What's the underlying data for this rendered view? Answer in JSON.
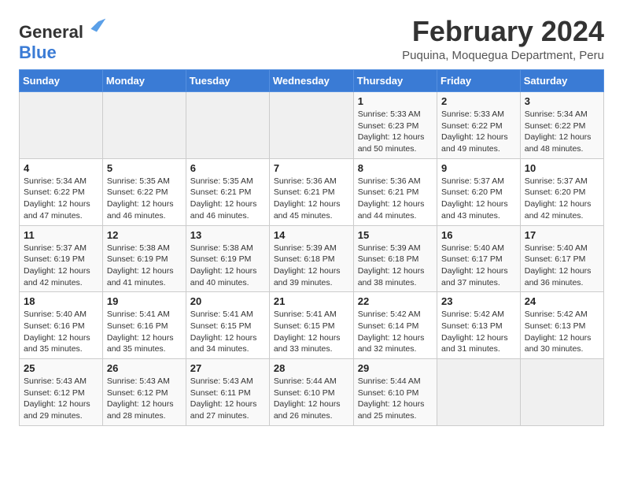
{
  "header": {
    "logo_general": "General",
    "logo_blue": "Blue",
    "month_title": "February 2024",
    "location": "Puquina, Moquegua Department, Peru"
  },
  "weekdays": [
    "Sunday",
    "Monday",
    "Tuesday",
    "Wednesday",
    "Thursday",
    "Friday",
    "Saturday"
  ],
  "weeks": [
    [
      {
        "day": "",
        "info": ""
      },
      {
        "day": "",
        "info": ""
      },
      {
        "day": "",
        "info": ""
      },
      {
        "day": "",
        "info": ""
      },
      {
        "day": "1",
        "info": "Sunrise: 5:33 AM\nSunset: 6:23 PM\nDaylight: 12 hours\nand 50 minutes."
      },
      {
        "day": "2",
        "info": "Sunrise: 5:33 AM\nSunset: 6:22 PM\nDaylight: 12 hours\nand 49 minutes."
      },
      {
        "day": "3",
        "info": "Sunrise: 5:34 AM\nSunset: 6:22 PM\nDaylight: 12 hours\nand 48 minutes."
      }
    ],
    [
      {
        "day": "4",
        "info": "Sunrise: 5:34 AM\nSunset: 6:22 PM\nDaylight: 12 hours\nand 47 minutes."
      },
      {
        "day": "5",
        "info": "Sunrise: 5:35 AM\nSunset: 6:22 PM\nDaylight: 12 hours\nand 46 minutes."
      },
      {
        "day": "6",
        "info": "Sunrise: 5:35 AM\nSunset: 6:21 PM\nDaylight: 12 hours\nand 46 minutes."
      },
      {
        "day": "7",
        "info": "Sunrise: 5:36 AM\nSunset: 6:21 PM\nDaylight: 12 hours\nand 45 minutes."
      },
      {
        "day": "8",
        "info": "Sunrise: 5:36 AM\nSunset: 6:21 PM\nDaylight: 12 hours\nand 44 minutes."
      },
      {
        "day": "9",
        "info": "Sunrise: 5:37 AM\nSunset: 6:20 PM\nDaylight: 12 hours\nand 43 minutes."
      },
      {
        "day": "10",
        "info": "Sunrise: 5:37 AM\nSunset: 6:20 PM\nDaylight: 12 hours\nand 42 minutes."
      }
    ],
    [
      {
        "day": "11",
        "info": "Sunrise: 5:37 AM\nSunset: 6:19 PM\nDaylight: 12 hours\nand 42 minutes."
      },
      {
        "day": "12",
        "info": "Sunrise: 5:38 AM\nSunset: 6:19 PM\nDaylight: 12 hours\nand 41 minutes."
      },
      {
        "day": "13",
        "info": "Sunrise: 5:38 AM\nSunset: 6:19 PM\nDaylight: 12 hours\nand 40 minutes."
      },
      {
        "day": "14",
        "info": "Sunrise: 5:39 AM\nSunset: 6:18 PM\nDaylight: 12 hours\nand 39 minutes."
      },
      {
        "day": "15",
        "info": "Sunrise: 5:39 AM\nSunset: 6:18 PM\nDaylight: 12 hours\nand 38 minutes."
      },
      {
        "day": "16",
        "info": "Sunrise: 5:40 AM\nSunset: 6:17 PM\nDaylight: 12 hours\nand 37 minutes."
      },
      {
        "day": "17",
        "info": "Sunrise: 5:40 AM\nSunset: 6:17 PM\nDaylight: 12 hours\nand 36 minutes."
      }
    ],
    [
      {
        "day": "18",
        "info": "Sunrise: 5:40 AM\nSunset: 6:16 PM\nDaylight: 12 hours\nand 35 minutes."
      },
      {
        "day": "19",
        "info": "Sunrise: 5:41 AM\nSunset: 6:16 PM\nDaylight: 12 hours\nand 35 minutes."
      },
      {
        "day": "20",
        "info": "Sunrise: 5:41 AM\nSunset: 6:15 PM\nDaylight: 12 hours\nand 34 minutes."
      },
      {
        "day": "21",
        "info": "Sunrise: 5:41 AM\nSunset: 6:15 PM\nDaylight: 12 hours\nand 33 minutes."
      },
      {
        "day": "22",
        "info": "Sunrise: 5:42 AM\nSunset: 6:14 PM\nDaylight: 12 hours\nand 32 minutes."
      },
      {
        "day": "23",
        "info": "Sunrise: 5:42 AM\nSunset: 6:13 PM\nDaylight: 12 hours\nand 31 minutes."
      },
      {
        "day": "24",
        "info": "Sunrise: 5:42 AM\nSunset: 6:13 PM\nDaylight: 12 hours\nand 30 minutes."
      }
    ],
    [
      {
        "day": "25",
        "info": "Sunrise: 5:43 AM\nSunset: 6:12 PM\nDaylight: 12 hours\nand 29 minutes."
      },
      {
        "day": "26",
        "info": "Sunrise: 5:43 AM\nSunset: 6:12 PM\nDaylight: 12 hours\nand 28 minutes."
      },
      {
        "day": "27",
        "info": "Sunrise: 5:43 AM\nSunset: 6:11 PM\nDaylight: 12 hours\nand 27 minutes."
      },
      {
        "day": "28",
        "info": "Sunrise: 5:44 AM\nSunset: 6:10 PM\nDaylight: 12 hours\nand 26 minutes."
      },
      {
        "day": "29",
        "info": "Sunrise: 5:44 AM\nSunset: 6:10 PM\nDaylight: 12 hours\nand 25 minutes."
      },
      {
        "day": "",
        "info": ""
      },
      {
        "day": "",
        "info": ""
      }
    ]
  ]
}
